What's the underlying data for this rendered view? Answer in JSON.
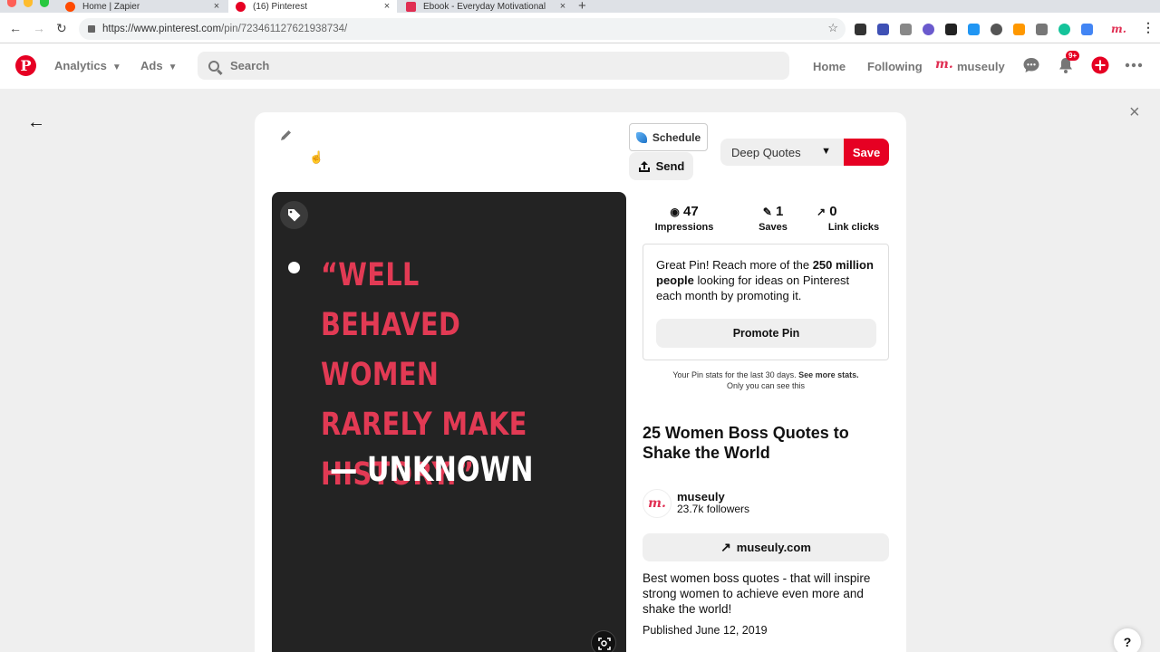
{
  "browser": {
    "tabs": [
      {
        "title": "Home | Zapier",
        "favicon_color": "#ff4a00"
      },
      {
        "title": "(16) Pinterest",
        "favicon_color": "#e60023"
      },
      {
        "title": "Ebook - Everyday Motivational",
        "favicon_color": "#e02e52"
      }
    ],
    "url_host": "https://www.pinterest.com",
    "url_path": "/pin/723461127621938734/"
  },
  "header": {
    "logo": "P",
    "analytics_label": "Analytics",
    "ads_label": "Ads",
    "search_placeholder": "Search",
    "home_label": "Home",
    "following_label": "Following",
    "profile_logo": "m.",
    "profile_name": "museuly",
    "notification_badge": "9+"
  },
  "pin": {
    "schedule_label": "Schedule",
    "send_label": "Send",
    "board_selected": "Deep Quotes",
    "save_label": "Save",
    "image_quote": "“WELL BEHAVED WOMEN RARELY MAKE HISTORY.”",
    "image_author": "— UNKNOWN",
    "stats": {
      "impressions_value": "47",
      "impressions_label": "Impressions",
      "saves_value": "1",
      "saves_label": "Saves",
      "clicks_value": "0",
      "clicks_label": "Link clicks"
    },
    "promo": {
      "text_before": "Great Pin! Reach more of the ",
      "text_bold": "250 million people",
      "text_after": " looking for ideas on Pinterest each month by promoting it.",
      "button_label": "Promote Pin"
    },
    "stats_note_1": "Your Pin stats for the last 30 days.",
    "stats_note_link": "See more stats.",
    "stats_note_2": "Only you can see this",
    "title": "25 Women Boss Quotes to Shake the World",
    "creator_avatar": "m.",
    "creator_name": "museuly",
    "creator_followers": "23.7k followers",
    "site_label": "museuly.com",
    "description": "Best women boss quotes - that will inspire strong women to achieve even more and shake the world!",
    "published": "Published June 12, 2019"
  },
  "colors": {
    "brand_red": "#e60023",
    "quote_red": "#e23a54",
    "image_bg": "#232323"
  }
}
